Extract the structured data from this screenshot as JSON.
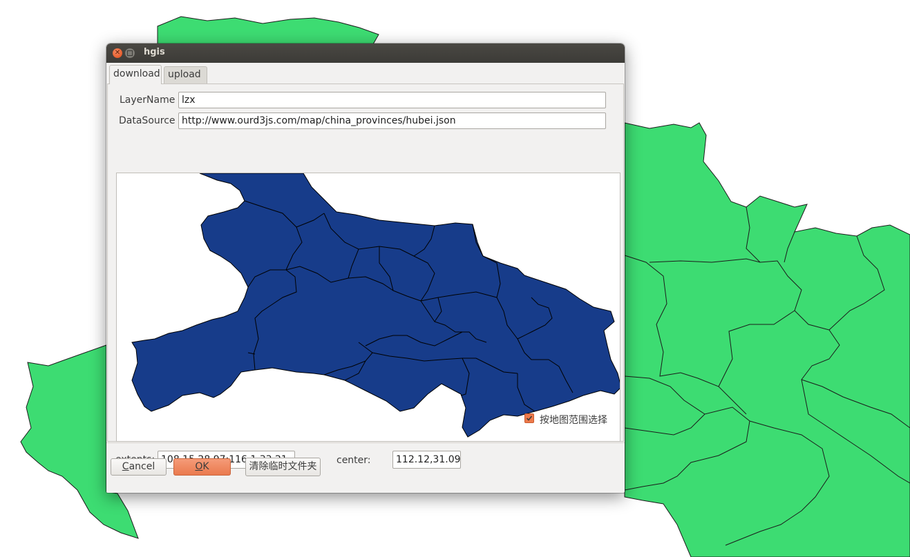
{
  "window": {
    "title": "hgis"
  },
  "tabs": [
    {
      "label": "download",
      "active": true
    },
    {
      "label": "upload",
      "active": false
    }
  ],
  "form": {
    "layer_name_label": "LayerName",
    "layer_name_value": "lzx",
    "data_source_label": "DataSource",
    "data_source_value": "http://www.ourd3js.com/map/china_provinces/hubei.json",
    "extents_label": "extents:",
    "extents_value": "108.15,28.97:116.1,33.21",
    "center_label": "center:",
    "center_value": "112.12,31.09",
    "select_by_map_label": "按地图范围选择",
    "select_by_map_checked": true
  },
  "buttons": {
    "cancel_first": "C",
    "cancel_rest": "ancel",
    "ok_first": "O",
    "ok_rest": "K",
    "clear_temp": "清除临时文件夹"
  },
  "colors": {
    "background_map_fill": "#3ddc72",
    "preview_map_fill": "#173c8a",
    "accent": "#ed7a4b",
    "titlebar": "#3c3b37"
  }
}
